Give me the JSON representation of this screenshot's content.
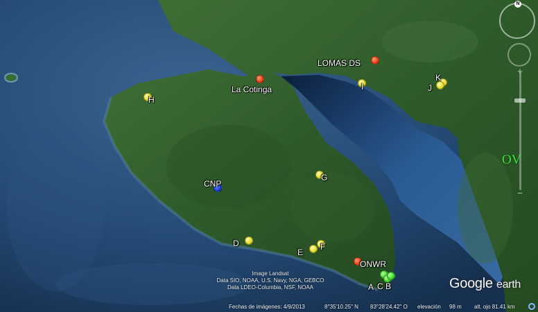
{
  "places": [
    {
      "id": "cnp",
      "label": "CNP",
      "color": "blue"
    },
    {
      "id": "la-cotinga",
      "label": "La Cotinga",
      "color": "red"
    },
    {
      "id": "lomas-ds",
      "label": "LOMAS DS",
      "color": "red"
    },
    {
      "id": "onwr",
      "label": "ONWR",
      "color": "red"
    },
    {
      "id": "h",
      "label": "H",
      "color": "yellow"
    },
    {
      "id": "i",
      "label": "I",
      "color": "yellow"
    },
    {
      "id": "k",
      "label": "K",
      "color": "yellow"
    },
    {
      "id": "j",
      "label": "J",
      "color": "yellow"
    },
    {
      "id": "g",
      "label": "G",
      "color": "yellow"
    },
    {
      "id": "d",
      "label": "D",
      "color": "yellow"
    },
    {
      "id": "e",
      "label": "E",
      "color": "yellow"
    },
    {
      "id": "f",
      "label": "F",
      "color": "yellow"
    },
    {
      "id": "a",
      "label": "A",
      "color": "green"
    },
    {
      "id": "c",
      "label": "C",
      "color": "green"
    },
    {
      "id": "b",
      "label": "B",
      "color": "green"
    }
  ],
  "overlay_label": "OV",
  "overlay_color": "#3fe03a",
  "credits": [
    "Image Landsat",
    "Data SIO, NOAA, U.S. Navy, NGA, GEBCO",
    "Data LDEO-Columbia, NSF, NOAA"
  ],
  "status": {
    "imagery_date": "Fechas de imágenes: 4/9/2013",
    "lat": "8°35'10.25\" N",
    "lon": "83°28'24.42\" O",
    "elevation_label": "elevación",
    "elevation": "98 m",
    "eye_alt": "alt. ojo  81.41 km"
  },
  "logo": {
    "main": "Google",
    "sub": "earth"
  },
  "compass_north": "N",
  "zoom_plus": "+",
  "zoom_minus": "−",
  "colors": {
    "sea": "#1c3a5e",
    "land": "#2f5a2a",
    "yellow": "#e6dc2a",
    "red": "#e8401a",
    "blue": "#1a3fd8",
    "green": "#3ed82a"
  },
  "icons": [
    "compass-icon",
    "look-joystick-icon",
    "zoom-slider-icon",
    "status-circle-icon"
  ]
}
